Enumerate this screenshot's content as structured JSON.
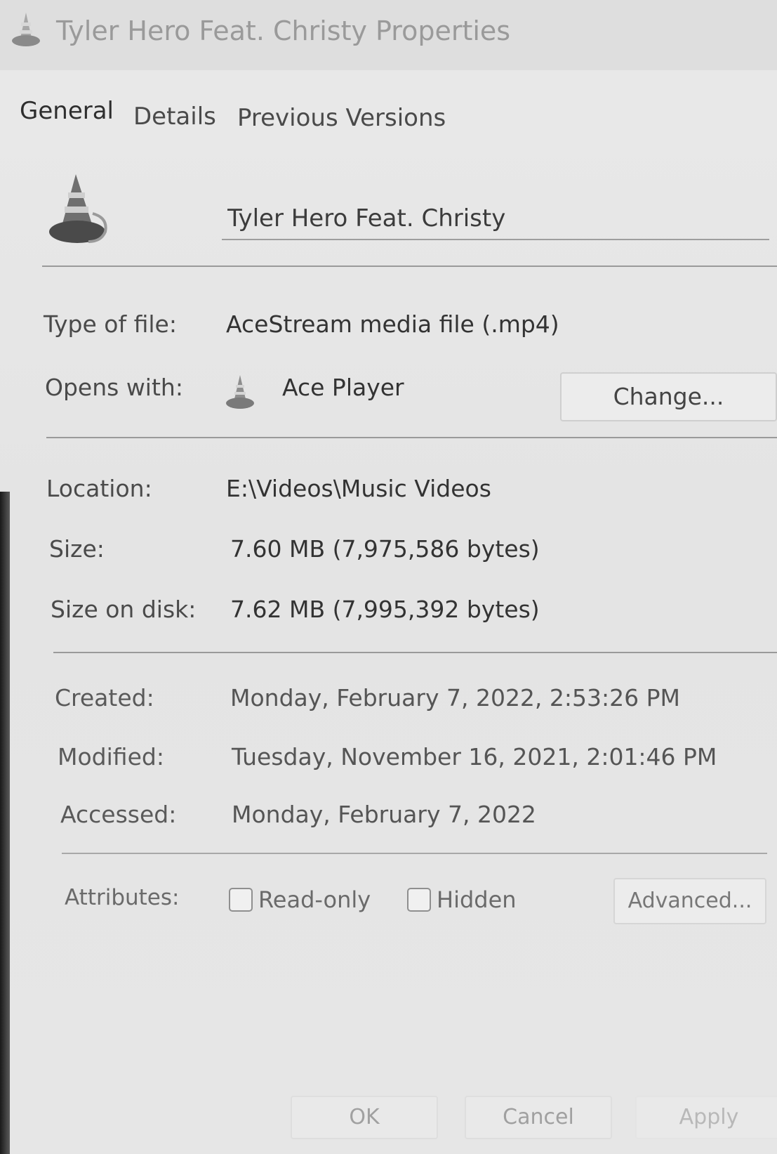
{
  "window": {
    "title": "Tyler Hero Feat. Christy Properties"
  },
  "tabs": [
    {
      "label": "General",
      "active": true
    },
    {
      "label": "Details",
      "active": false
    },
    {
      "label": "Previous Versions",
      "active": false
    }
  ],
  "file": {
    "icon": "traffic-cone-icon",
    "name": "Tyler Hero Feat. Christy"
  },
  "details": {
    "type_label": "Type of file:",
    "type_value": "AceStream media file (.mp4)",
    "opens_label": "Opens with:",
    "opens_value": "Ace Player",
    "change_label": "Change...",
    "location_label": "Location:",
    "location_value": "E:\\Videos\\Music Videos",
    "size_label": "Size:",
    "size_value": "7.60 MB (7,975,586 bytes)",
    "size_on_disk_label": "Size on disk:",
    "size_on_disk_value": "7.62 MB (7,995,392 bytes)",
    "created_label": "Created:",
    "created_value": "Monday, February 7, 2022, 2:53:26 PM",
    "modified_label": "Modified:",
    "modified_value": "Tuesday, November 16, 2021, 2:01:46 PM",
    "accessed_label": "Accessed:",
    "accessed_value": "Monday, February 7, 2022"
  },
  "attributes": {
    "label": "Attributes:",
    "readonly_label": "Read-only",
    "readonly_checked": false,
    "hidden_label": "Hidden",
    "hidden_checked": false,
    "advanced_label": "Advanced..."
  },
  "buttons": {
    "ok": "OK",
    "cancel": "Cancel",
    "apply": "Apply"
  }
}
